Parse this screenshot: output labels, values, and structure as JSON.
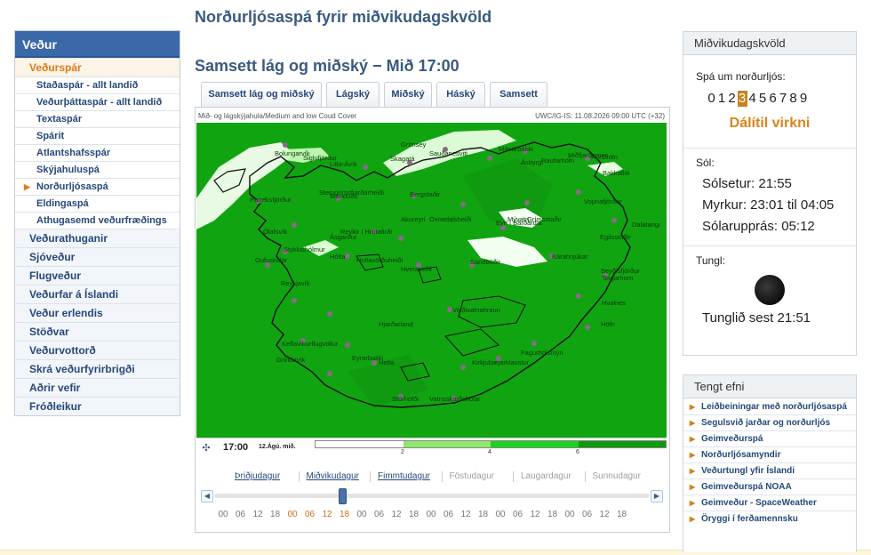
{
  "page": {
    "title": "Norðurljósaspá fyrir miðvikudagskvöld"
  },
  "nav": {
    "header": "Veður",
    "items": [
      {
        "label": "Veðurspár",
        "level": 1,
        "active": true
      },
      {
        "label": "Staðaspár - allt landið",
        "level": 2
      },
      {
        "label": "Veðurþáttaspár - allt landið",
        "level": 2
      },
      {
        "label": "Textaspár",
        "level": 2
      },
      {
        "label": "Spárit",
        "level": 2
      },
      {
        "label": "Atlantshafsspár",
        "level": 2
      },
      {
        "label": "Skýjahuluspá",
        "level": 2
      },
      {
        "label": "Norðurljósaspá",
        "level": 2,
        "current": true
      },
      {
        "label": "Eldingaspá",
        "level": 2
      },
      {
        "label": "Athugasemd veðurfræðings",
        "level": 2
      },
      {
        "label": "Veðurathuganir",
        "level": 1
      },
      {
        "label": "Sjóveður",
        "level": 1
      },
      {
        "label": "Flugveður",
        "level": 1
      },
      {
        "label": "Veðurfar á Íslandi",
        "level": 1
      },
      {
        "label": "Veður erlendis",
        "level": 1
      },
      {
        "label": "Stöðvar",
        "level": 1
      },
      {
        "label": "Veðurvottorð",
        "level": 1
      },
      {
        "label": "Skrá veðurfyrirbrigði",
        "level": 1
      },
      {
        "label": "Aðrir vefir",
        "level": 1
      },
      {
        "label": "Fróðleikur",
        "level": 1
      }
    ]
  },
  "main": {
    "subtitle": "Samsett lág og miðský − Mið 17:00",
    "tabs": [
      "Samsett lág og miðský",
      "Lágský",
      "Miðský",
      "Háský",
      "Samsett"
    ],
    "map": {
      "caption_left": "Mið- og lágskýjahula/Medium and low Coud Cover",
      "caption_right": "UWC/IG-IS: 11.08.2026 09:00 UTC (+32)",
      "places": [
        "Bolungarvík",
        "Siglufjörður",
        "Grímsey",
        "Sauðanesviti",
        "Mánárbakki",
        "Raufarhöfn",
        "Þórshöfn",
        "Skagatá",
        "Litla-Ávík",
        "Ásbyrgi",
        "Miðfjarðarnes",
        "Bakkaflói",
        "Patreksfjörður",
        "Steingrímsfjarðarheiði",
        "Blönduós",
        "Bergstaðir",
        "Akureyri",
        "Mývatn",
        "Grímsstaðir",
        "Vopnafjörður",
        "Ólafsvík",
        "Ásgarður",
        "Reykir í Hrútafirði",
        "Öxnadalsheiði",
        "Kárahnjúkar",
        "Dalatangi",
        "Stykkishólmur",
        "Hólta",
        "Eyri í Bárðardal",
        "Egilsstaðir",
        "Gufuskálar",
        "Holtavörðuheiði",
        "Hveravellir",
        "Sandbúðir",
        "Seyðisfjörður",
        "Reykjavík",
        "Grindavík",
        "Keflavíkurflugvöllur",
        "Hjarðarland",
        "Veiðivatnahraun",
        "Teigarhorn",
        "Hvalnes",
        "Hella",
        "Eyrarbakki",
        "Kirkjubæjarklaustur",
        "Fagurhólsmýri",
        "Stórhöfði",
        "Vatnsskarðshólar",
        "Höfn"
      ]
    },
    "scalebar": {
      "time": "17:00",
      "date": "12.Ágú. mið.",
      "ticks": [
        "2",
        "4",
        "6"
      ]
    },
    "timeline": {
      "days": [
        {
          "label": "Þriðjudagur",
          "link": true
        },
        {
          "label": "Miðvikudagur",
          "link": true
        },
        {
          "label": "Fimmtudagur",
          "link": true
        },
        {
          "label": "Föstudagur",
          "link": false
        },
        {
          "label": "Laugardagur",
          "link": false
        },
        {
          "label": "Sunnudagur",
          "link": false
        }
      ],
      "hours": [
        "00",
        "06",
        "12",
        "18",
        "00",
        "06",
        "12",
        "18",
        "00",
        "06",
        "12",
        "18",
        "00",
        "06",
        "12",
        "18",
        "00",
        "06",
        "12",
        "18",
        "00",
        "06",
        "12",
        "18"
      ],
      "prev": "◀",
      "next": "▶"
    }
  },
  "right": {
    "panel1": {
      "title": "Miðvikudagskvöld",
      "forecast_label": "Spá um norðurljós:",
      "kp": [
        "0",
        "1",
        "2",
        "3",
        "4",
        "5",
        "6",
        "7",
        "8",
        "9"
      ],
      "kp_selected": 3,
      "activity": "Dálítil virkni",
      "sun_label": "Sól:",
      "sunset": "Sólsetur: 21:55",
      "dark": "Myrkur: 23:01 til 04:05",
      "sunrise": "Sólarupprás: 05:12",
      "moon_label": "Tungl:",
      "moonset": "Tunglið sest 21:51"
    },
    "panel2": {
      "title": "Tengt efni",
      "links": [
        "Leiðbeiningar með norðurljósaspá",
        "Segulsvið jarðar og norðurljós",
        "Geimveðurspá",
        "Norðurljósamyndir",
        "Veðurtungl yfir Íslandi",
        "Geimveðurspá NOAA",
        "Geimveður - SpaceWeather",
        "Öryggi í ferðamennsku"
      ]
    }
  },
  "colors": {
    "map_green": "#11a411",
    "scale": [
      "#ffffff",
      "#8ee86a",
      "#1fd11f",
      "#0c990c"
    ],
    "accent": "#e07a19",
    "nav_head": "#3a68a8"
  }
}
